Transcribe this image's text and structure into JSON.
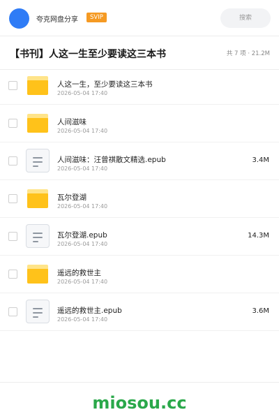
{
  "header": {
    "brand": "夸克网盘分享",
    "badge": "SVIP",
    "search_placeholder": "搜索"
  },
  "share": {
    "title": "【书刊】人这一生至少要读这三本书",
    "summary": "共 7 项 · 21.2M"
  },
  "files": [
    {
      "name": "人这一生，至少要读这三本书",
      "date": "2026-05-04 17:40",
      "size": "",
      "type": "folder"
    },
    {
      "name": "人间滋味",
      "date": "2026-05-04 17:40",
      "size": "",
      "type": "folder"
    },
    {
      "name": "人间滋味：汪曾祺散文精选.epub",
      "date": "2026-05-04 17:40",
      "size": "3.4M",
      "type": "file"
    },
    {
      "name": "瓦尔登湖",
      "date": "2026-05-04 17:40",
      "size": "",
      "type": "folder"
    },
    {
      "name": "瓦尔登湖.epub",
      "date": "2026-05-04 17:40",
      "size": "14.3M",
      "type": "file"
    },
    {
      "name": "遥远的救世主",
      "date": "2026-05-04 17:40",
      "size": "",
      "type": "folder"
    },
    {
      "name": "遥远的救世主.epub",
      "date": "2026-05-04 17:40",
      "size": "3.6M",
      "type": "file"
    }
  ],
  "footer": {
    "watermark": "miosou.cc"
  },
  "colors": {
    "avatar": "#2f7cf6",
    "badge": "#f59a23",
    "folder": "#ffc21a",
    "watermark": "#2aa84a"
  },
  "icons": {
    "folder": "folder-icon",
    "file": "document-icon",
    "checkbox": "checkbox-icon"
  }
}
